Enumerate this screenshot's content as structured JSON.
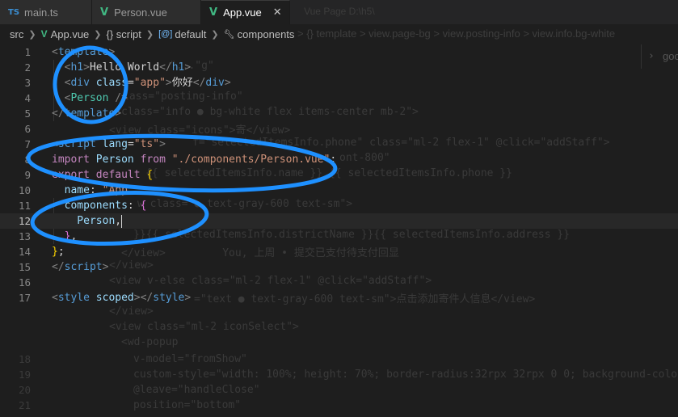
{
  "tabs": [
    {
      "label": "main.ts",
      "icon": "ts-icon",
      "active": false
    },
    {
      "label": "Person.vue",
      "icon": "vue-icon",
      "active": false
    },
    {
      "label": "App.vue",
      "icon": "vue-icon",
      "active": true
    }
  ],
  "breadcrumb": {
    "items": [
      "src",
      "App.vue",
      "{} script",
      "default",
      "components"
    ]
  },
  "editor": {
    "line_numbers": [
      "1",
      "2",
      "3",
      "4",
      "5",
      "6",
      "7",
      "8",
      "9",
      "10",
      "11",
      "12",
      "13",
      "14",
      "15",
      "16",
      "17"
    ],
    "lines": [
      [
        {
          "t": "<",
          "c": "t-punc"
        },
        {
          "t": "template",
          "c": "t-tag"
        },
        {
          "t": ">",
          "c": "t-punc"
        }
      ],
      [
        {
          "t": "  <",
          "c": "t-punc"
        },
        {
          "t": "h1",
          "c": "t-tag"
        },
        {
          "t": ">",
          "c": "t-punc"
        },
        {
          "t": "Hello World",
          "c": "t-text"
        },
        {
          "t": "</",
          "c": "t-punc"
        },
        {
          "t": "h1",
          "c": "t-tag"
        },
        {
          "t": ">",
          "c": "t-punc"
        }
      ],
      [
        {
          "t": "  <",
          "c": "t-punc"
        },
        {
          "t": "div",
          "c": "t-tag"
        },
        {
          "t": " ",
          "c": "t-text"
        },
        {
          "t": "class",
          "c": "t-attr"
        },
        {
          "t": "=",
          "c": "t-text"
        },
        {
          "t": "\"app\"",
          "c": "t-str"
        },
        {
          "t": ">",
          "c": "t-punc"
        },
        {
          "t": "你好",
          "c": "t-text"
        },
        {
          "t": "</",
          "c": "t-punc"
        },
        {
          "t": "div",
          "c": "t-tag"
        },
        {
          "t": ">",
          "c": "t-punc"
        }
      ],
      [
        {
          "t": "  <",
          "c": "t-punc"
        },
        {
          "t": "Person",
          "c": "t-comp"
        },
        {
          "t": " />",
          "c": "t-punc"
        }
      ],
      [
        {
          "t": "</",
          "c": "t-punc"
        },
        {
          "t": "template",
          "c": "t-tag"
        },
        {
          "t": ">",
          "c": "t-punc"
        }
      ],
      [],
      [
        {
          "t": "<",
          "c": "t-punc"
        },
        {
          "t": "script",
          "c": "t-tag"
        },
        {
          "t": " ",
          "c": "t-text"
        },
        {
          "t": "lang",
          "c": "t-attr"
        },
        {
          "t": "=",
          "c": "t-text"
        },
        {
          "t": "\"ts\"",
          "c": "t-str"
        },
        {
          "t": ">",
          "c": "t-punc"
        }
      ],
      [
        {
          "t": "import",
          "c": "t-kw"
        },
        {
          "t": " Person ",
          "c": "t-attr"
        },
        {
          "t": "from",
          "c": "t-kw"
        },
        {
          "t": " ",
          "c": "t-text"
        },
        {
          "t": "\"./components/Person.vue\"",
          "c": "t-str"
        },
        {
          "t": ";",
          "c": "t-text"
        }
      ],
      [
        {
          "t": "export",
          "c": "t-kw"
        },
        {
          "t": " ",
          "c": "t-text"
        },
        {
          "t": "default",
          "c": "t-kw"
        },
        {
          "t": " ",
          "c": "t-text"
        },
        {
          "t": "{",
          "c": "t-brace"
        }
      ],
      [
        {
          "t": "  name",
          "c": "t-attr"
        },
        {
          "t": ": ",
          "c": "t-text"
        },
        {
          "t": "\"App\"",
          "c": "t-str"
        },
        {
          "t": ",",
          "c": "t-text"
        }
      ],
      [
        {
          "t": "  components",
          "c": "t-attr"
        },
        {
          "t": ": ",
          "c": "t-text"
        },
        {
          "t": "{",
          "c": "t-brace2"
        }
      ],
      [
        {
          "t": "    Person",
          "c": "t-attr"
        },
        {
          "t": ",",
          "c": "t-text"
        }
      ],
      [
        {
          "t": "  ",
          "c": "t-text"
        },
        {
          "t": "}",
          "c": "t-brace2"
        },
        {
          "t": ",",
          "c": "t-text"
        }
      ],
      [
        {
          "t": "}",
          "c": "t-brace"
        },
        {
          "t": ";",
          "c": "t-text"
        }
      ],
      [
        {
          "t": "</",
          "c": "t-punc"
        },
        {
          "t": "script",
          "c": "t-tag"
        },
        {
          "t": ">",
          "c": "t-punc"
        }
      ],
      [],
      [
        {
          "t": "<",
          "c": "t-punc"
        },
        {
          "t": "style",
          "c": "t-tag"
        },
        {
          "t": " ",
          "c": "t-text"
        },
        {
          "t": "scoped",
          "c": "t-attr"
        },
        {
          "t": ">",
          "c": "t-punc"
        },
        {
          "t": "</",
          "c": "t-punc"
        },
        {
          "t": "style",
          "c": "t-tag"
        },
        {
          "t": ">",
          "c": "t-punc"
        }
      ]
    ],
    "current_line": 12,
    "colors": {
      "background": "#1e1e1e",
      "annotation": "#1e90ff",
      "vue_icon": "#41b883",
      "ts_icon": "#3b8fd3"
    }
  },
  "annotations": [
    "circle-template-block",
    "ellipse-import-line",
    "ellipse-components-block"
  ]
}
